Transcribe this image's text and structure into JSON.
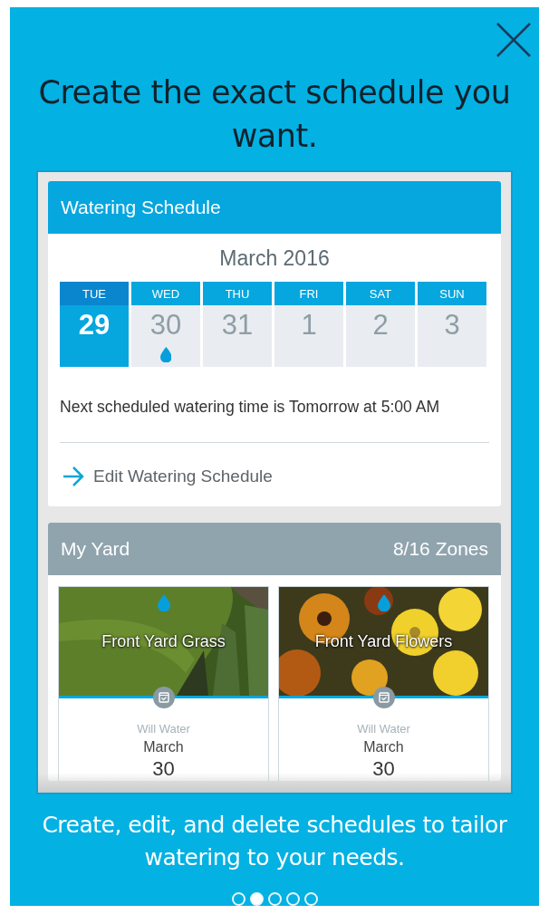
{
  "title": "Create the exact schedule you want.",
  "schedule_card": {
    "title": "Watering Schedule",
    "month": "March 2016",
    "days": [
      {
        "weekday": "TUE",
        "date": "29",
        "selected": true,
        "watering": false
      },
      {
        "weekday": "WED",
        "date": "30",
        "selected": false,
        "watering": true
      },
      {
        "weekday": "THU",
        "date": "31",
        "selected": false,
        "watering": false
      },
      {
        "weekday": "FRI",
        "date": "1",
        "selected": false,
        "watering": false
      },
      {
        "weekday": "SAT",
        "date": "2",
        "selected": false,
        "watering": false
      },
      {
        "weekday": "SUN",
        "date": "3",
        "selected": false,
        "watering": false
      }
    ],
    "next_watering": "Next scheduled watering time is Tomorrow at 5:00 AM",
    "edit_link": "Edit Watering Schedule"
  },
  "yard_card": {
    "title": "My Yard",
    "zones_count": "8/16 Zones",
    "zones": [
      {
        "name": "Front Yard Grass",
        "kind": "grass",
        "label": "Will Water",
        "month": "March",
        "date": "30"
      },
      {
        "name": "Front Yard Flowers",
        "kind": "flowers",
        "label": "Will Water",
        "month": "March",
        "date": "30"
      }
    ]
  },
  "caption": "Create, edit, and delete schedules to tailor watering to your needs.",
  "pages": [
    {
      "selected": false
    },
    {
      "selected": true
    },
    {
      "selected": false
    },
    {
      "selected": false
    },
    {
      "selected": false
    }
  ]
}
